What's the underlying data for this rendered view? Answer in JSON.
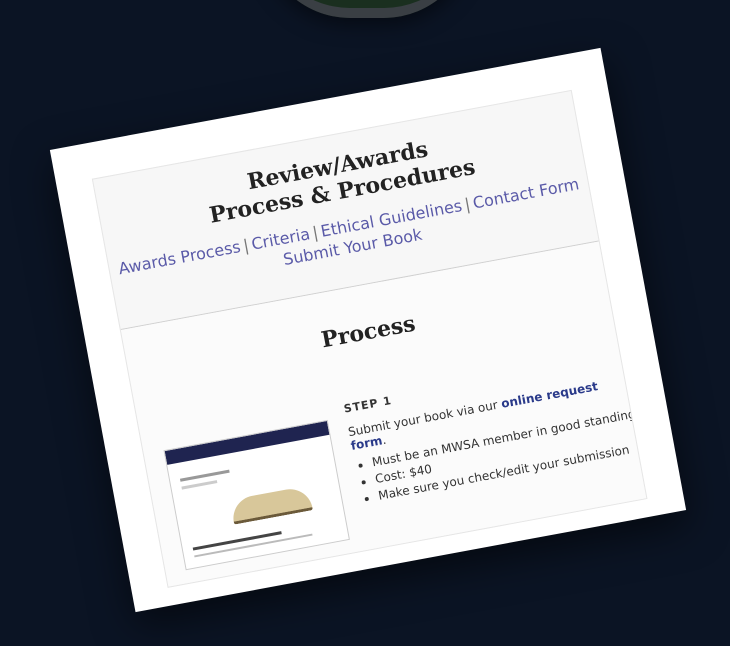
{
  "header": {
    "title_line1": "Review/Awards",
    "title_line2": "Process & Procedures"
  },
  "nav": {
    "links": [
      {
        "label": "Awards Process"
      },
      {
        "label": "Criteria"
      },
      {
        "label": "Ethical Guidelines"
      },
      {
        "label": "Contact Form"
      },
      {
        "label": "Submit Your Book"
      }
    ],
    "separator": "|"
  },
  "section": {
    "title": "Process",
    "step": {
      "label": "STEP 1",
      "text_before": "Submit your book via our",
      "link_text": "online request form",
      "text_after": ".",
      "bullets": [
        "Must be an MWSA member in good standing",
        "Cost: $40",
        "Make sure you check/edit your submission"
      ]
    }
  },
  "colors": {
    "background": "#0b1424",
    "link": "#5a5aa8",
    "accent_link": "#2a3a8a"
  }
}
